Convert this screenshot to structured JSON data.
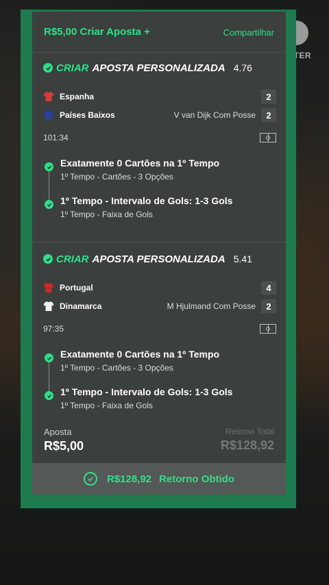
{
  "header": {
    "title": "R$5,00 Criar Aposta +",
    "share_label": "Compartilhar"
  },
  "background": {
    "partial_label": "TER"
  },
  "bets": [
    {
      "heading_word1": "CRIAR",
      "heading_word2": "APOSTA PERSONALIZADA",
      "odds": "4.76",
      "teams": [
        {
          "name": "Espanha",
          "stat": "",
          "score": "2",
          "kit_color": "#d63a3a"
        },
        {
          "name": "Países Baixos",
          "stat": "V van Dijk Com Posse",
          "score": "2",
          "kit_color": "#2a3f9e"
        }
      ],
      "time": "101:34",
      "legs": [
        {
          "title": "Exatamente 0 Cartões na 1º Tempo",
          "subtitle": "1º Tempo - Cartões - 3 Opções"
        },
        {
          "title": "1º Tempo - Intervalo de Gols: 1-3 Gols",
          "subtitle": "1º Tempo - Faixa de Gols"
        }
      ]
    },
    {
      "heading_word1": "CRIAR",
      "heading_word2": "APOSTA PERSONALIZADA",
      "odds": "5.41",
      "teams": [
        {
          "name": "Portugal",
          "stat": "",
          "score": "4",
          "kit_color": "#c92a2a"
        },
        {
          "name": "Dinamarca",
          "stat": "M Hjulmand Com Posse",
          "score": "2",
          "kit_color": "#f2f2f2"
        }
      ],
      "time": "97:35",
      "legs": [
        {
          "title": "Exatamente 0 Cartões na 1º Tempo",
          "subtitle": "1º Tempo - Cartões - 3 Opções"
        },
        {
          "title": "1º Tempo - Intervalo de Gols: 1-3 Gols",
          "subtitle": "1º Tempo - Faixa de Gols"
        }
      ]
    }
  ],
  "summary": {
    "stake_label": "Aposta",
    "stake_value": "R$5,00",
    "return_label": "Retorno Total",
    "return_value": "R$128,92"
  },
  "result": {
    "amount": "R$128,92",
    "label": "Retorno Obtido"
  },
  "colors": {
    "accent": "#2ee08a",
    "frame": "#1f7a4f",
    "card": "#3b3f3d"
  }
}
